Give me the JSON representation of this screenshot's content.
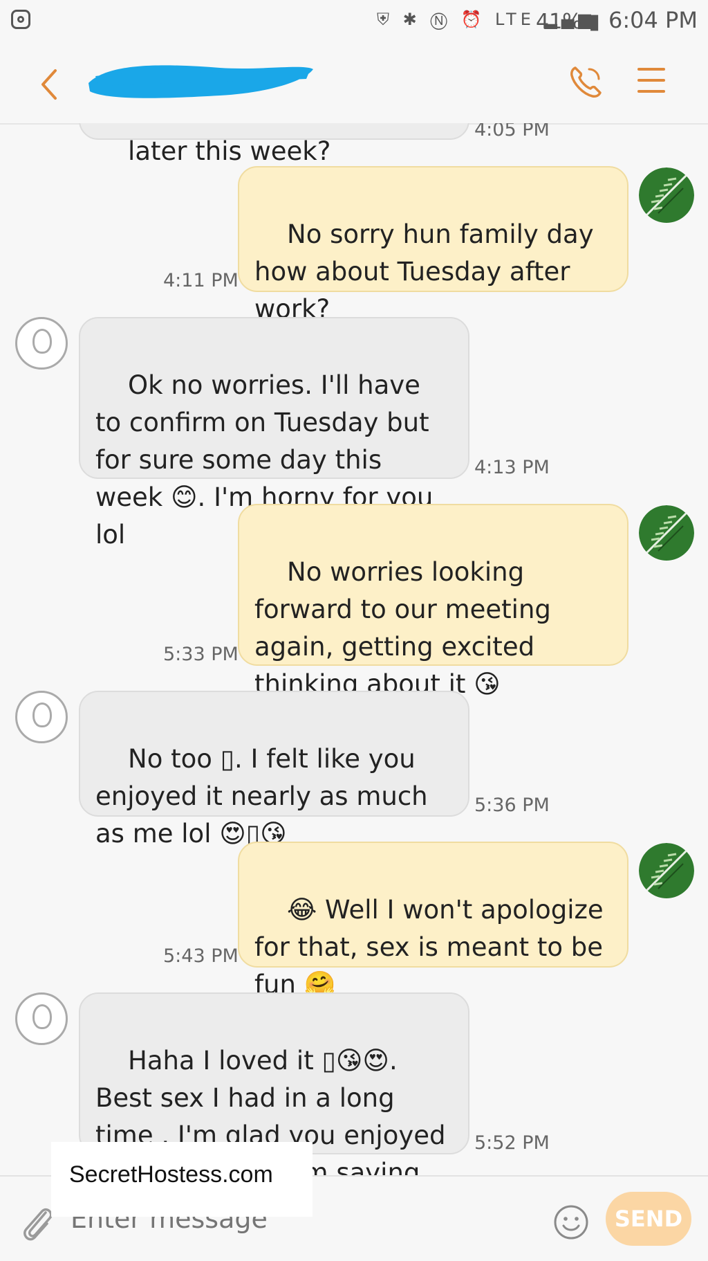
{
  "status_bar": {
    "icons": "⛨ ✱ Ⓝ ⏰ LTE ▂▄▆",
    "battery": "41%",
    "time": "6:04 PM"
  },
  "header": {
    "contact_name_redacted": true
  },
  "messages": [
    {
      "side": "in",
      "text": "later this week?",
      "time": "4:05 PM"
    },
    {
      "side": "out",
      "text": "No sorry hun family day how about Tuesday after work?",
      "time": "4:11 PM"
    },
    {
      "side": "in",
      "text": "Ok no worries. I'll have to confirm on Tuesday but for sure some day this week 😊. I'm horny for you lol",
      "time": "4:13 PM"
    },
    {
      "side": "out",
      "text": "No worries looking forward to our meeting again, getting excited thinking about it 😘",
      "time": "5:33 PM"
    },
    {
      "side": "in",
      "text": "No too ▯. I felt like you enjoyed it nearly as much as me lol 😍▯😘",
      "time": "5:36 PM"
    },
    {
      "side": "out",
      "text": "😂 Well I won't apologize for that, sex is meant to be fun 🤗",
      "time": "5:43 PM"
    },
    {
      "side": "in",
      "text": "Haha I loved it ▯😘😍. Best sex I had in a long time . I'm glad you enjoyed it too that's all I'm saying haha .",
      "time": "5:52 PM"
    }
  ],
  "input": {
    "placeholder": "Enter message",
    "send_label": "SEND"
  },
  "watermark": "SecretHostess.com",
  "colors": {
    "accent": "#e0893a",
    "out_bubble": "#fdf0c8",
    "in_bubble": "#ececec",
    "send_button": "#fbd6a4"
  }
}
